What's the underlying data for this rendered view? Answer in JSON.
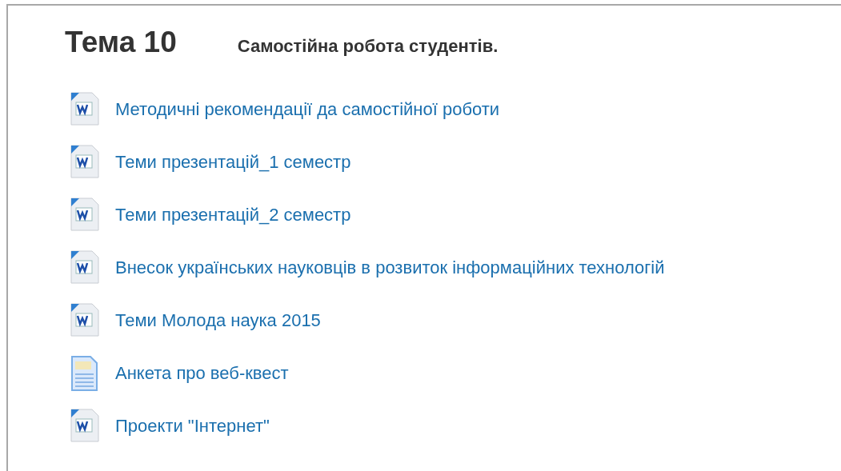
{
  "section": {
    "title": "Тема 10",
    "summary": "Самостійна робота студентів."
  },
  "resources": [
    {
      "kind": "word",
      "label": "Методичні рекомендації да самостійної роботи"
    },
    {
      "kind": "word",
      "label": "Теми презентацій_1 семестр"
    },
    {
      "kind": "word",
      "label": "Теми презентацій_2 семестр"
    },
    {
      "kind": "word",
      "label": "Внесок українських науковців в розвиток інформаційних технологій"
    },
    {
      "kind": "word",
      "label": "Теми Молода наука 2015"
    },
    {
      "kind": "document",
      "label": "Анкета про веб-квест"
    },
    {
      "kind": "word",
      "label": "Проекти \"Інтернет\""
    }
  ]
}
